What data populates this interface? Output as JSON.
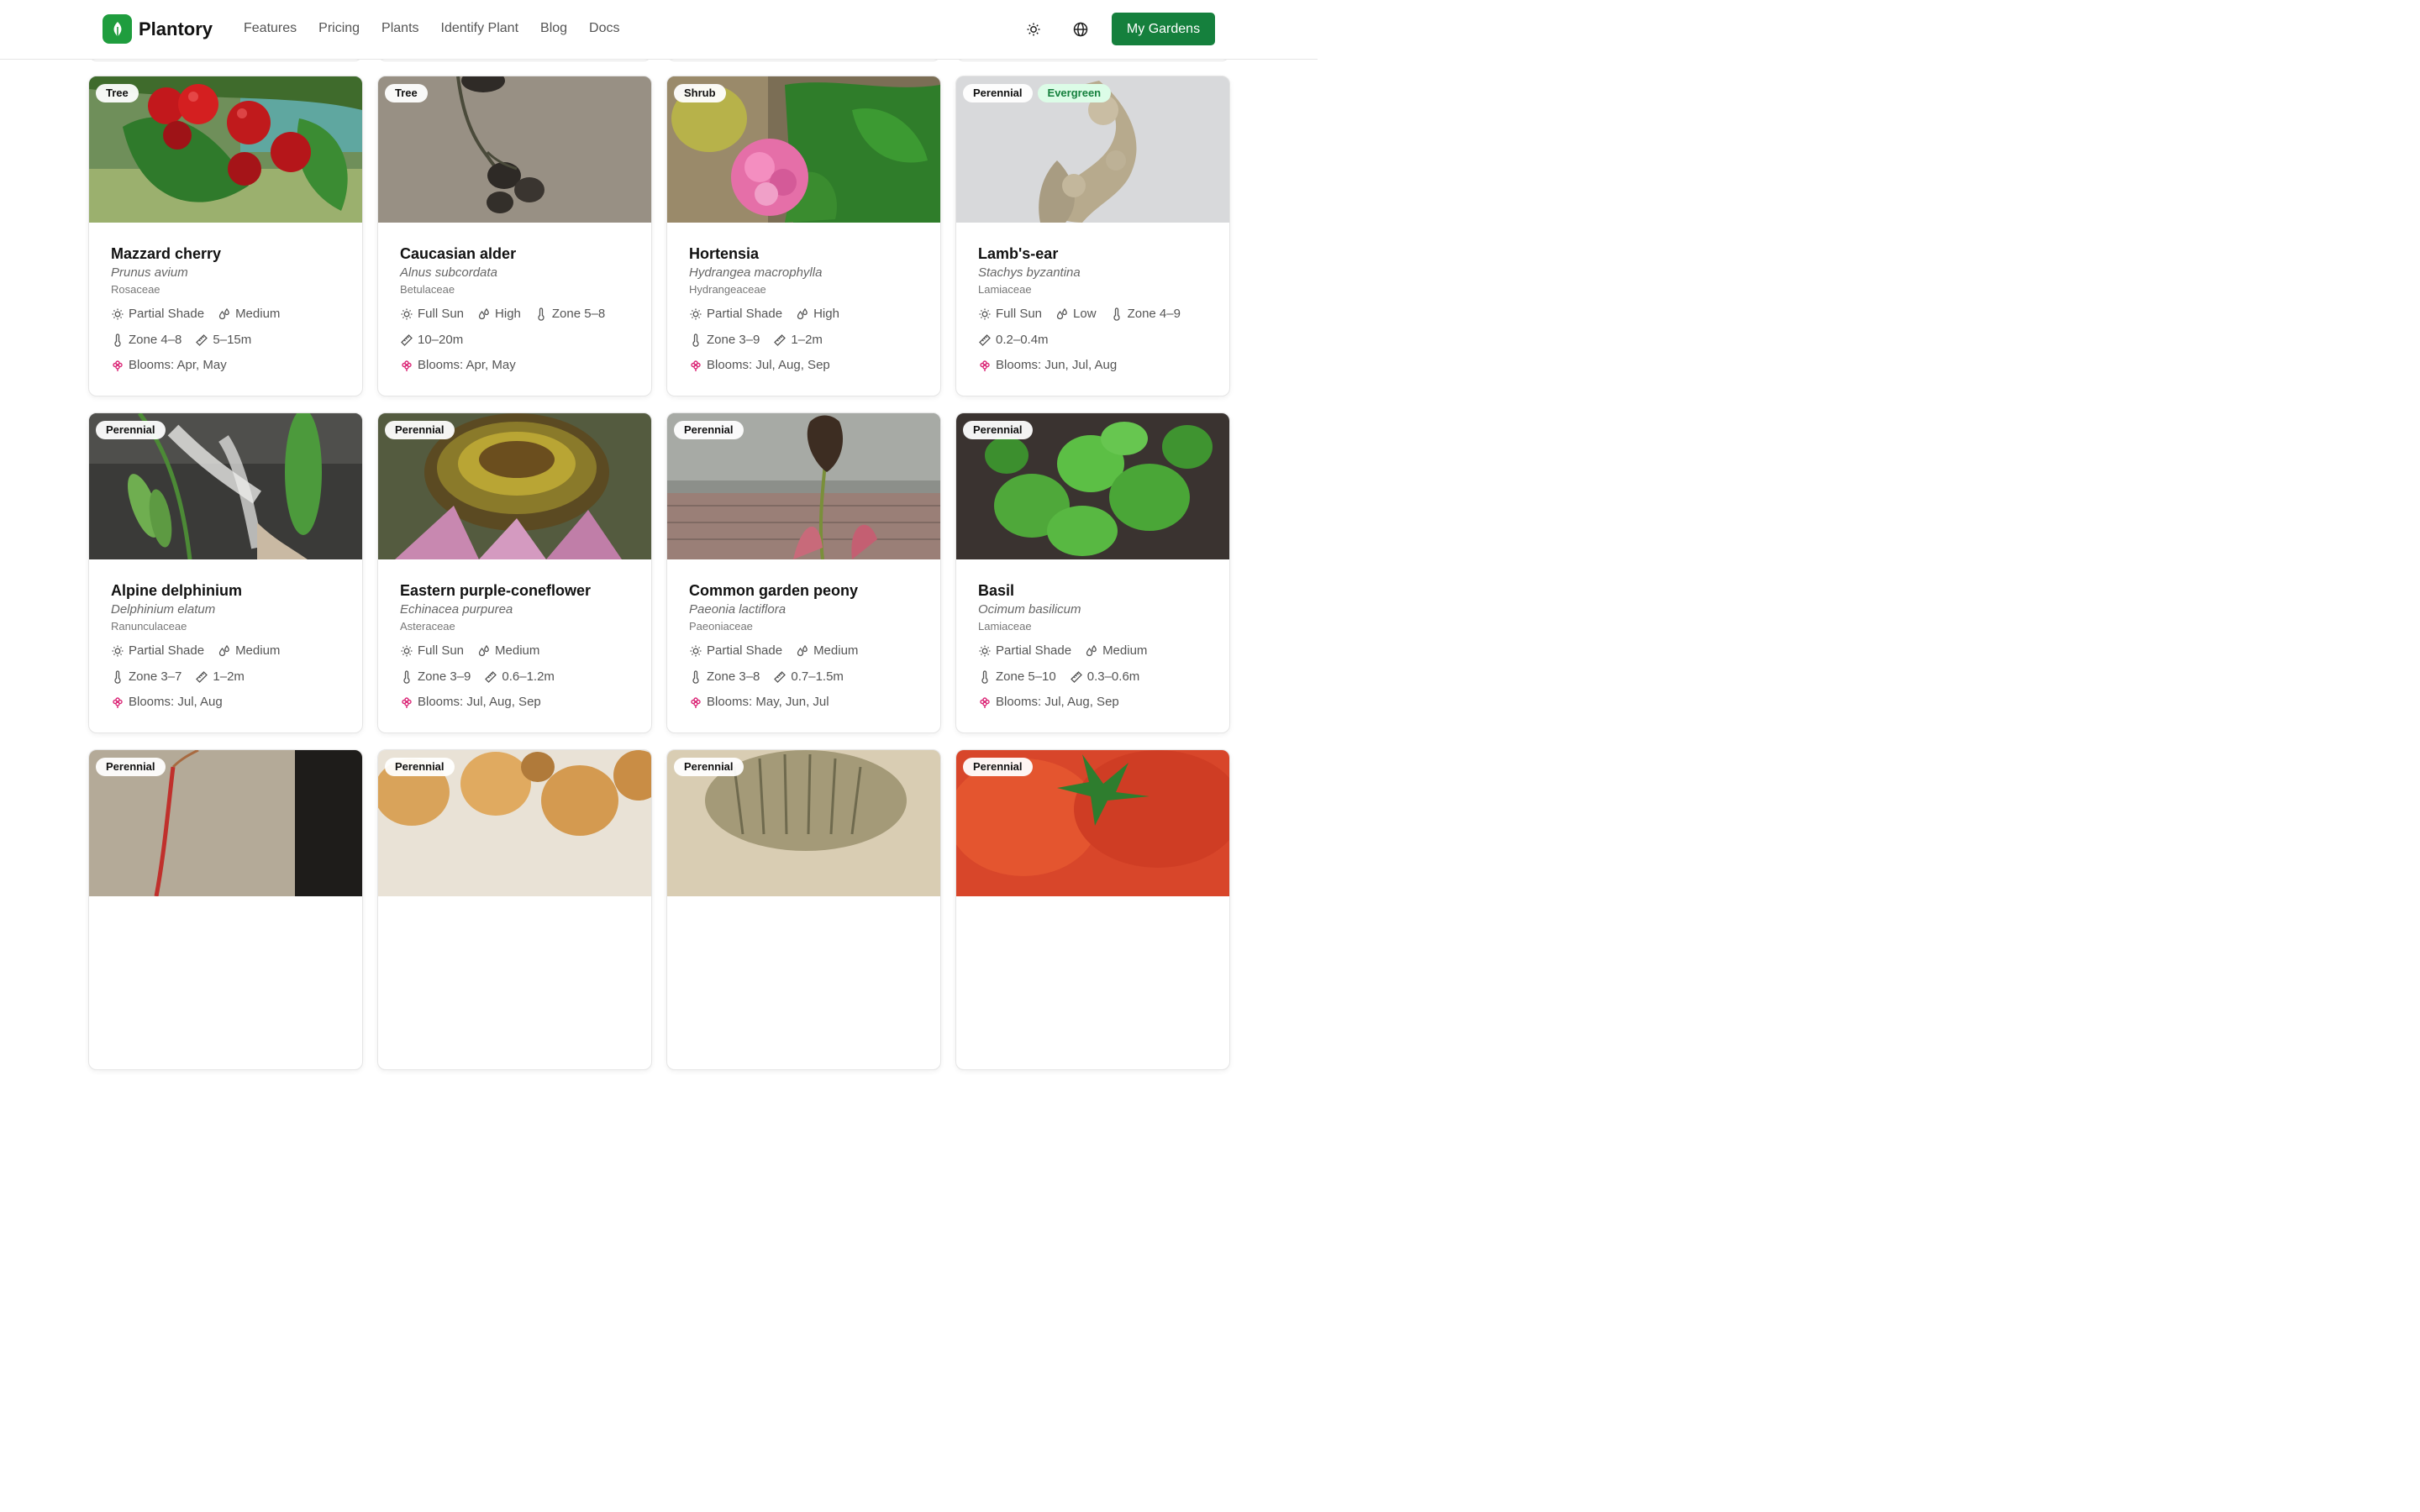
{
  "brand": {
    "name": "Plantory"
  },
  "nav": [
    "Features",
    "Pricing",
    "Plants",
    "Identify Plant",
    "Blog",
    "Docs"
  ],
  "header_actions": {
    "theme_icon": "sun-icon",
    "language_icon": "globe-icon",
    "cta_label": "My Gardens"
  },
  "colors": {
    "brand": "#15803d",
    "bloom_icon": "#db2777",
    "evergreen_bg": "#dcfce7"
  },
  "plants": [
    {
      "tags": [
        "Tree"
      ],
      "name": "Mazzard cherry",
      "scientific": "Prunus avium",
      "family": "Rosaceae",
      "light": "Partial Shade",
      "water": "Medium",
      "zone": "Zone 4–8",
      "height": "5–15m",
      "blooms": "Blooms: Apr, May"
    },
    {
      "tags": [
        "Tree"
      ],
      "name": "Caucasian alder",
      "scientific": "Alnus subcordata",
      "family": "Betulaceae",
      "light": "Full Sun",
      "water": "High",
      "zone": "Zone 5–8",
      "height": "10–20m",
      "blooms": "Blooms: Apr, May"
    },
    {
      "tags": [
        "Shrub"
      ],
      "name": "Hortensia",
      "scientific": "Hydrangea macrophylla",
      "family": "Hydrangeaceae",
      "light": "Partial Shade",
      "water": "High",
      "zone": "Zone 3–9",
      "height": "1–2m",
      "blooms": "Blooms: Jul, Aug, Sep"
    },
    {
      "tags": [
        "Perennial",
        "Evergreen"
      ],
      "name": "Lamb's-ear",
      "scientific": "Stachys byzantina",
      "family": "Lamiaceae",
      "light": "Full Sun",
      "water": "Low",
      "zone": "Zone 4–9",
      "height": "0.2–0.4m",
      "blooms": "Blooms: Jun, Jul, Aug"
    },
    {
      "tags": [
        "Perennial"
      ],
      "name": "Alpine delphinium",
      "scientific": "Delphinium elatum",
      "family": "Ranunculaceae",
      "light": "Partial Shade",
      "water": "Medium",
      "zone": "Zone 3–7",
      "height": "1–2m",
      "blooms": "Blooms: Jul, Aug"
    },
    {
      "tags": [
        "Perennial"
      ],
      "name": "Eastern purple-coneflower",
      "scientific": "Echinacea purpurea",
      "family": "Asteraceae",
      "light": "Full Sun",
      "water": "Medium",
      "zone": "Zone 3–9",
      "height": "0.6–1.2m",
      "blooms": "Blooms: Jul, Aug, Sep"
    },
    {
      "tags": [
        "Perennial"
      ],
      "name": "Common garden peony",
      "scientific": "Paeonia lactiflora",
      "family": "Paeoniaceae",
      "light": "Partial Shade",
      "water": "Medium",
      "zone": "Zone 3–8",
      "height": "0.7–1.5m",
      "blooms": "Blooms: May, Jun, Jul"
    },
    {
      "tags": [
        "Perennial"
      ],
      "name": "Basil",
      "scientific": "Ocimum basilicum",
      "family": "Lamiaceae",
      "light": "Partial Shade",
      "water": "Medium",
      "zone": "Zone 5–10",
      "height": "0.3–0.6m",
      "blooms": "Blooms: Jul, Aug, Sep"
    },
    {
      "tags": [
        "Perennial"
      ]
    },
    {
      "tags": [
        "Perennial"
      ]
    },
    {
      "tags": [
        "Perennial"
      ]
    },
    {
      "tags": [
        "Perennial"
      ]
    }
  ]
}
